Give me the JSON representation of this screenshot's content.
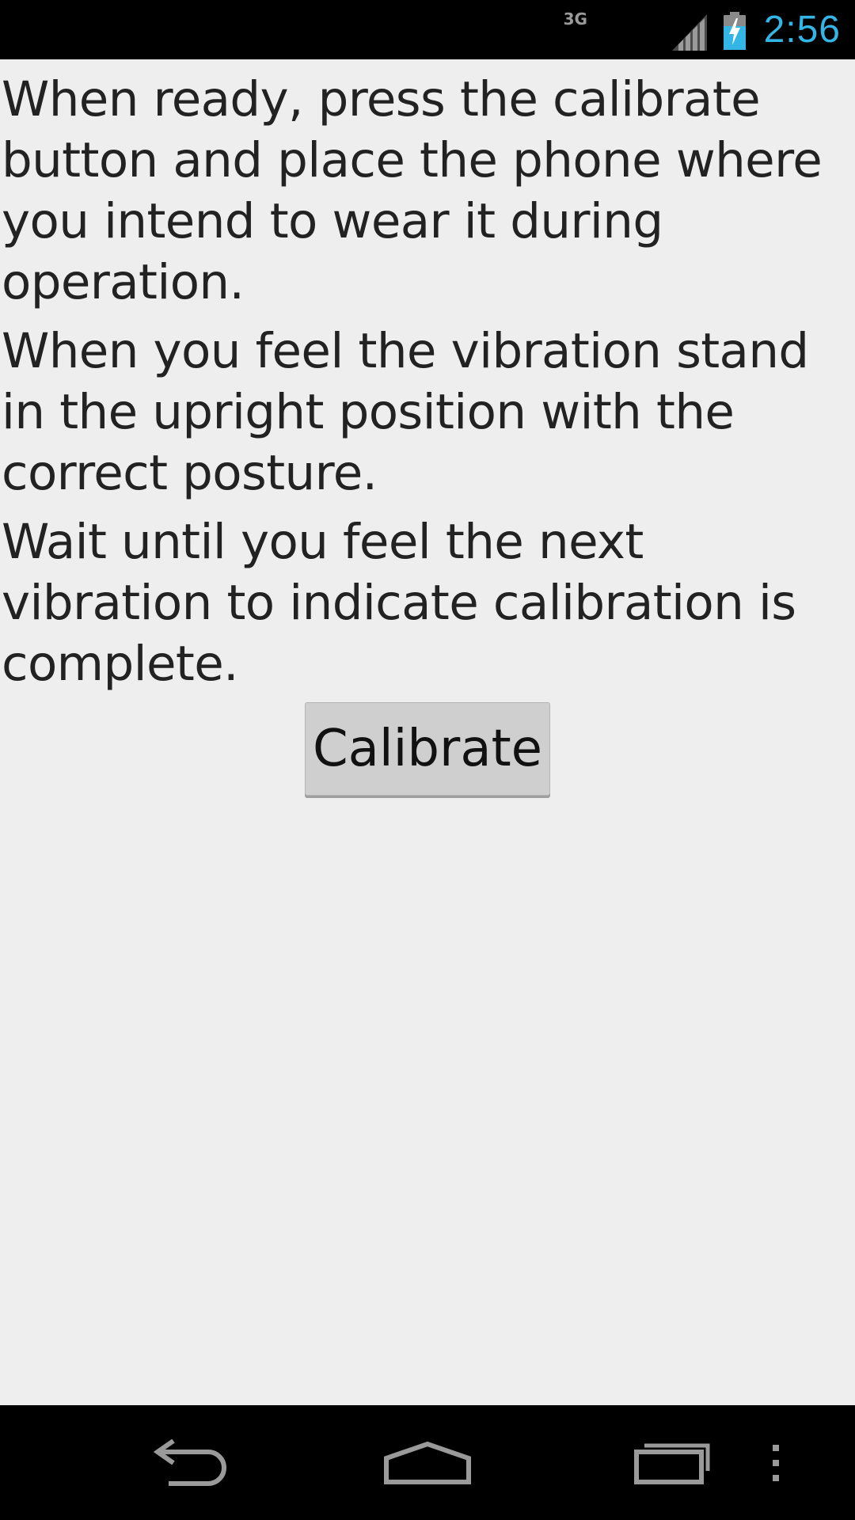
{
  "status_bar": {
    "network_type": "3G",
    "signal_icon": "signal-icon",
    "battery_icon": "battery-charging-icon",
    "time": "2:56",
    "clock_color": "#33b5e5"
  },
  "instructions": [
    "When ready, press the calibrate button and place the phone where you intend to wear it during operation.",
    "When you feel the vibration stand in the upright position with the correct posture.",
    "Wait until you feel the next vibration to indicate calibration is complete."
  ],
  "calibrate_button": {
    "label": "Calibrate"
  },
  "nav_bar": {
    "back_icon": "back-icon",
    "home_icon": "home-icon",
    "recents_icon": "recent-apps-icon",
    "menu_icon": "overflow-menu-icon"
  }
}
